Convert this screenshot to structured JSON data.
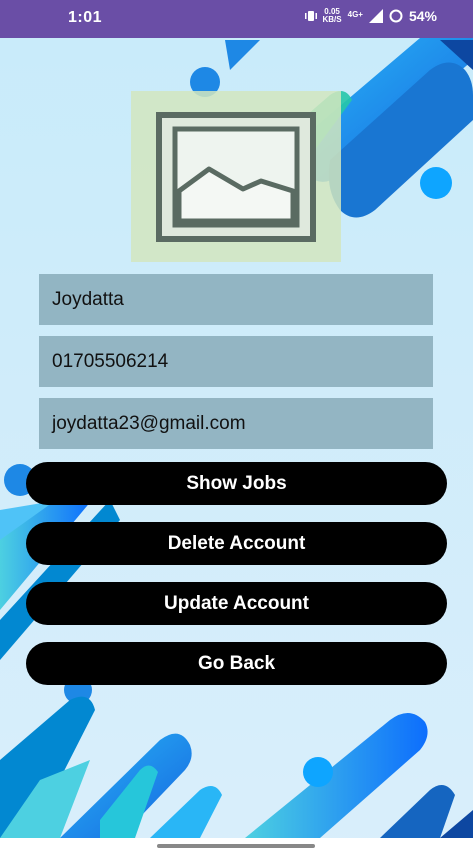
{
  "status_bar": {
    "time": "1:01",
    "net_speed_value": "0.05",
    "net_speed_unit": "KB/S",
    "network_type": "4G+",
    "battery": "54%",
    "color": "#6a4ea6"
  },
  "profile": {
    "image_icon": "image-placeholder-icon",
    "name": "Joydatta",
    "phone": "01705506214",
    "email": "joydatta23@gmail.com"
  },
  "buttons": {
    "show_jobs": "Show Jobs",
    "delete_account": "Delete Account",
    "update_account": "Update Account",
    "go_back": "Go Back"
  },
  "theme": {
    "background": "#cfeaf8",
    "button_color": "#000000",
    "accent_blue": "#1e7fe6"
  }
}
